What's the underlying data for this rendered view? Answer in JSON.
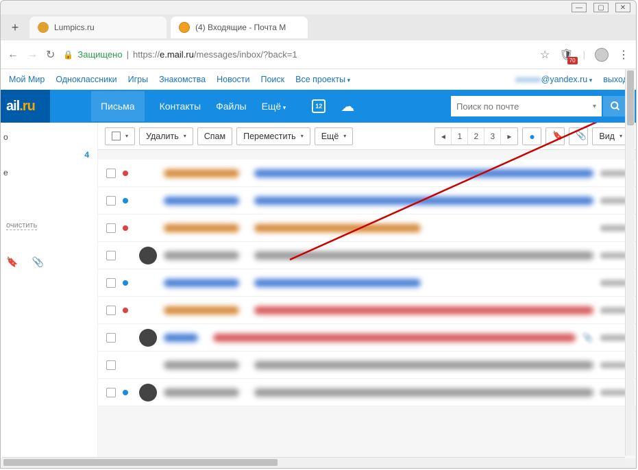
{
  "window": {
    "minimize": "—",
    "maximize": "▢",
    "close": "✕"
  },
  "tabs": {
    "tab1": "Lumpics.ru",
    "tab2": "(4) Входящие - Почта M"
  },
  "addressbar": {
    "secure": "Защищено",
    "url_scheme": "https://",
    "url_host": "e.mail.ru",
    "url_path": "/messages/inbox/?back=1",
    "ext_badge": "70"
  },
  "topbar": {
    "links": [
      "Мой Мир",
      "Одноклассники",
      "Игры",
      "Знакомства",
      "Новости",
      "Поиск",
      "Все проекты"
    ],
    "user_hidden": "xxxxxx",
    "user_domain": "@yandex.ru",
    "logout": "выход"
  },
  "header": {
    "logo_left": "ail",
    "logo_right": ".ru",
    "nav": [
      "Письма",
      "Контакты",
      "Файлы",
      "Ещё"
    ],
    "cal_day": "12",
    "search_placeholder": "Поиск по почте"
  },
  "toolbar": {
    "delete": "Удалить",
    "spam": "Спам",
    "move": "Переместить",
    "more": "Ещё",
    "pages": [
      "1",
      "2",
      "3"
    ],
    "view": "Вид"
  },
  "sidebar": {
    "frag1": "о",
    "count": "4",
    "frag2": "е",
    "clear": "очистить"
  }
}
